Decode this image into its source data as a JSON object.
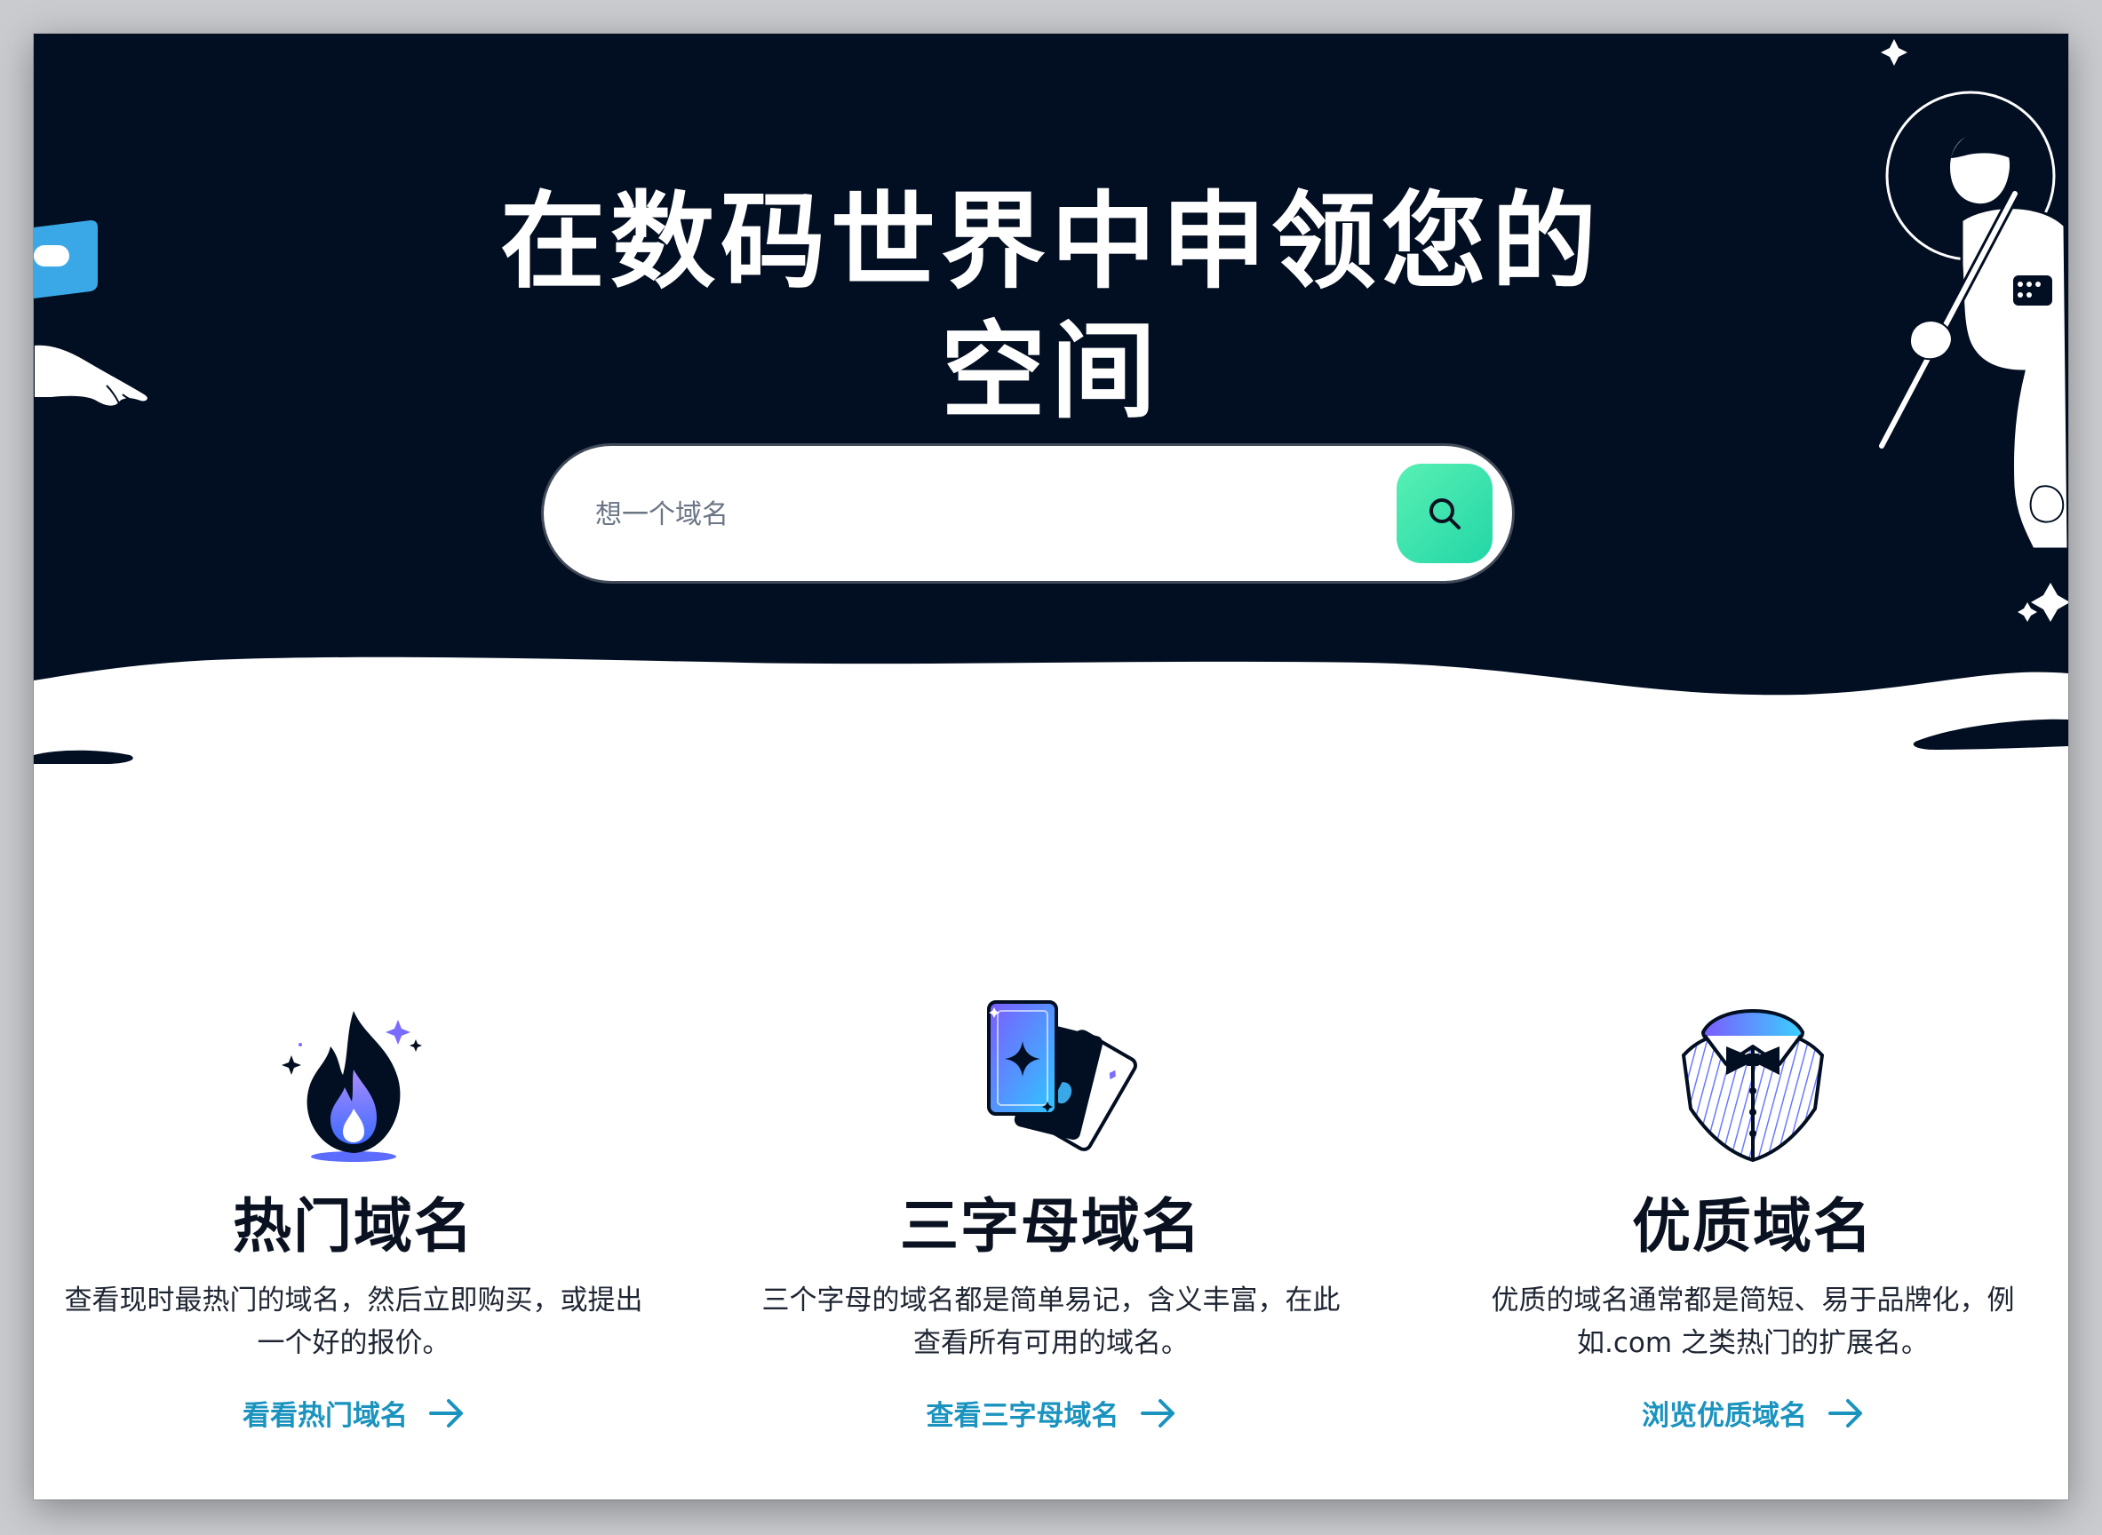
{
  "hero": {
    "title_line1": "在数码世界中申领您的",
    "title_line2": "空间",
    "search": {
      "placeholder": "想一个域名",
      "value": ""
    },
    "search_button_icon": "search-icon",
    "decor_icons": [
      "pointing-hand-flag-icon",
      "astronaut-with-pole-icon",
      "sparkle-star-icon"
    ]
  },
  "features": [
    {
      "icon": "flame-icon",
      "title": "热门域名",
      "description": "查看现时最热门的域名，然后立即购买，或提出一个好的报价。",
      "link_label": "看看热门域名",
      "link_icon": "arrow-right-icon"
    },
    {
      "icon": "playing-cards-icon",
      "title": "三字母域名",
      "description": "三个字母的域名都是简单易记，含义丰富，在此查看所有可用的域名。",
      "link_label": "查看三字母域名",
      "link_icon": "arrow-right-icon"
    },
    {
      "icon": "tuxedo-bowtie-icon",
      "title": "优质域名",
      "description": "优质的域名通常都是简短、易于品牌化，例如.com 之类热门的扩展名。",
      "link_label": "浏览优质域名",
      "link_icon": "arrow-right-icon"
    }
  ],
  "colors": {
    "hero_bg": "#020e21",
    "accent_green": "#2fe0ad",
    "link_blue": "#1a93bf",
    "heading": "#0a1120"
  }
}
